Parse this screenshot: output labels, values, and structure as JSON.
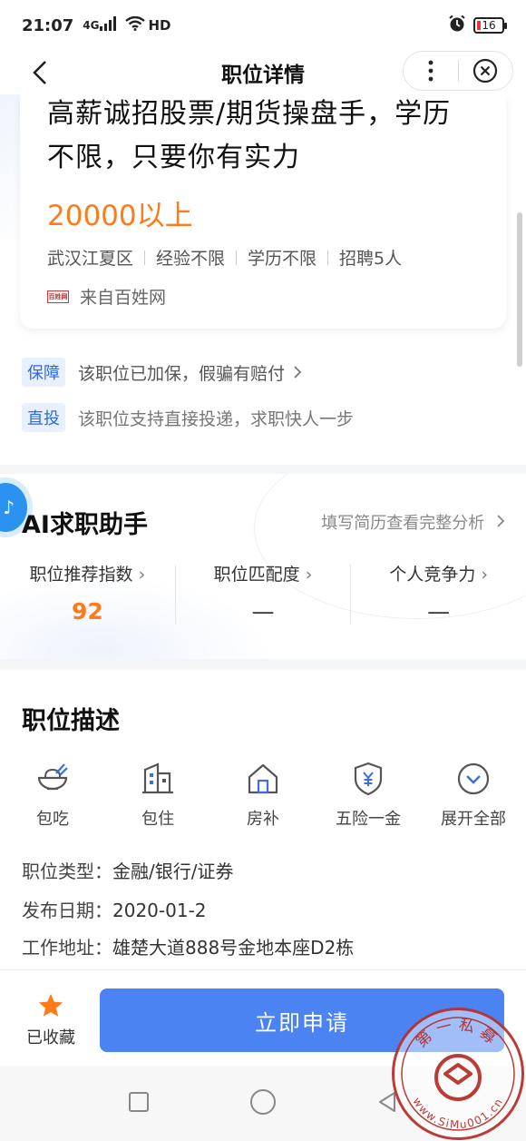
{
  "status_bar": {
    "time": "21:07",
    "network": "4G",
    "signal_label": "HD",
    "battery": "16"
  },
  "nav": {
    "title": "职位详情"
  },
  "job": {
    "title": "高薪诚招股票/期货操盘手，学历不限，只要你有实力",
    "salary": "20000以上",
    "location": "武汉江夏区",
    "experience": "经验不限",
    "education": "学历不限",
    "headcount": "招聘5人",
    "source_logo_text": "百姓网",
    "source": "来自百姓网"
  },
  "guarantees": [
    {
      "tag": "保障",
      "text": "该职位已加保，假骗有赔付",
      "has_arrow": true
    },
    {
      "tag": "直投",
      "text": "该职位支持直接投递，求职快人一步",
      "has_arrow": false
    }
  ],
  "ai": {
    "title": "AI求职助手",
    "link": "填写简历查看完整分析",
    "stats": [
      {
        "label": "职位推荐指数",
        "value": "92"
      },
      {
        "label": "职位匹配度",
        "value": "—"
      },
      {
        "label": "个人竞争力",
        "value": "—"
      }
    ]
  },
  "description": {
    "title": "职位描述",
    "benefits": [
      {
        "label": "包吃",
        "icon": "bowl-icon"
      },
      {
        "label": "包住",
        "icon": "building-icon"
      },
      {
        "label": "房补",
        "icon": "house-icon"
      },
      {
        "label": "五险一金",
        "icon": "shield-yen-icon"
      },
      {
        "label": "展开全部",
        "icon": "chevron-down-icon"
      }
    ],
    "job_type_label": "职位类型：",
    "job_type": "金融/银行/证券",
    "publish_date_label": "发布日期：",
    "publish_date": "2020-01-2",
    "address_label": "工作地址：",
    "address": "雄楚大道888号金地本座D2栋"
  },
  "bottom": {
    "fav_label": "已收藏",
    "apply_label": "立即申请"
  },
  "stamp": {
    "text_top": "第一私募",
    "text_bottom": "www.SiMu001.cn"
  },
  "colors": {
    "accent": "#4b83f2",
    "salary": "#ff7a1a",
    "tag_bg": "#e8f0fe",
    "tag_text": "#2f6ae0",
    "star": "#ff7a1a",
    "stamp": "#b7322d"
  }
}
